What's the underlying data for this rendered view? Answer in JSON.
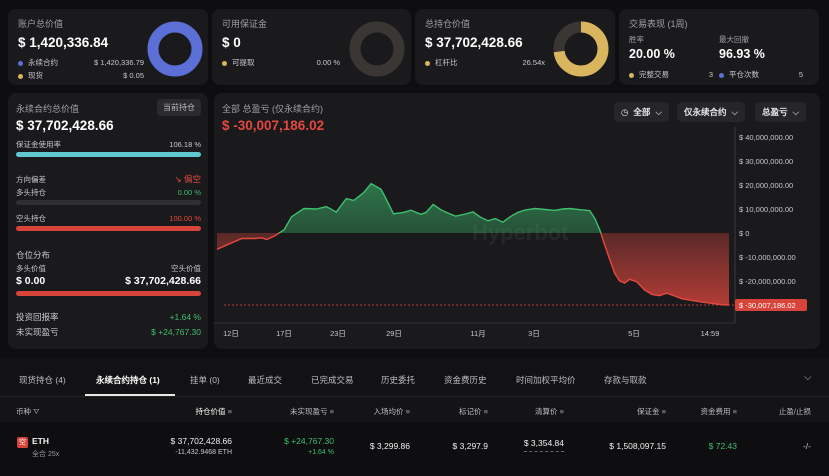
{
  "cards": {
    "account": {
      "title": "账户总价值",
      "value": "$ 1,420,336.84",
      "perp_label": "永续合约",
      "perp_value": "$ 1,420,336.79",
      "spot_label": "现货",
      "spot_value": "$ 0.05",
      "perp_fraction": 1.0
    },
    "margin": {
      "title": "可用保证金",
      "value": "$ 0",
      "withdraw_label": "可提取",
      "withdraw_value": "0.00 %",
      "fraction": 0.0
    },
    "position": {
      "title": "总持仓价值",
      "value": "$ 37,702,428.66",
      "leverage_label": "杠杆比",
      "leverage_value": "26.54x",
      "fraction": 0.73
    },
    "performance": {
      "title": "交易表现 (1周)",
      "winrate_label": "胜率",
      "winrate_value": "20.00 %",
      "drawdown_label": "最大回撤",
      "drawdown_value": "96.93 %",
      "trades_label": "完整交易",
      "trades_value": "3",
      "close_label": "平仓次数",
      "close_value": "5"
    }
  },
  "left": {
    "perp_total_label": "永续合约总价值",
    "current_pos_btn": "当前持仓",
    "perp_total_value": "$ 37,702,428.66",
    "margin_usage_label": "保证金使用率",
    "margin_usage_value": "106.18 %",
    "bias_label": "方向偏差",
    "bias_value": "偏空",
    "long_label": "多头持仓",
    "long_value": "0.00 %",
    "short_label": "空头持仓",
    "short_value": "100.00 %",
    "dist_label": "仓位分布",
    "long_value_label": "多头价值",
    "short_value_label": "空头价值",
    "long_amount": "$ 0.00",
    "short_amount": "$ 37,702,428.66",
    "roi_label": "投资回报率",
    "roi_value": "+1.64 %",
    "upnl_label": "未实现盈亏",
    "upnl_value": "$ +24,767.30"
  },
  "chart_header": {
    "title": "全部 总盈亏 (仅永续合约)",
    "value": "$ -30,007,186.02",
    "filter_all": "全部",
    "filter_perp": "仅永续合约",
    "filter_pnl": "总盈亏",
    "watermark": "Hyperbot"
  },
  "chart_data": {
    "type": "area",
    "title": "全部 总盈亏 (仅永续合约)",
    "x_ticks": [
      "12日",
      "17日",
      "23日",
      "29日",
      "11月",
      "3日",
      "5日",
      "14:59"
    ],
    "y_ticks": [
      "$ 40,000,000.00",
      "$ 30,000,000.00",
      "$ 20,000,000.00",
      "$ 10,000,000.00",
      "$ 0",
      "$ -10,000,000.00",
      "$ -20,000,000.00"
    ],
    "ylim": [
      -30007186.02,
      40000000
    ],
    "last_value_label": "$ -30,007,186.02",
    "points": [
      [
        0,
        -6800000
      ],
      [
        5,
        -4500000
      ],
      [
        10,
        -2300000
      ],
      [
        15,
        -2300000
      ],
      [
        18,
        -2000000
      ],
      [
        20,
        -2700000
      ],
      [
        23,
        -1300000
      ],
      [
        27,
        1300000
      ],
      [
        30,
        6800000
      ],
      [
        35,
        10200000
      ],
      [
        40,
        10000000
      ],
      [
        44,
        11000000
      ],
      [
        48,
        8700000
      ],
      [
        52,
        14300000
      ],
      [
        55,
        13600000
      ],
      [
        59,
        16800000
      ],
      [
        62,
        20600000
      ],
      [
        66,
        18200000
      ],
      [
        68,
        14300000
      ],
      [
        71,
        8000000
      ],
      [
        75,
        8600000
      ],
      [
        78,
        9500000
      ],
      [
        82,
        7800000
      ],
      [
        84,
        8500000
      ],
      [
        87,
        11900000
      ],
      [
        90,
        9700000
      ],
      [
        93,
        8300000
      ],
      [
        96,
        7000000
      ],
      [
        100,
        7900000
      ],
      [
        103,
        8800000
      ],
      [
        106,
        6600000
      ],
      [
        109,
        5100000
      ],
      [
        112,
        6000000
      ],
      [
        115,
        4500000
      ],
      [
        118,
        6800000
      ],
      [
        121,
        8600000
      ],
      [
        124,
        9600000
      ],
      [
        128,
        10200000
      ],
      [
        132,
        9800000
      ],
      [
        136,
        9400000
      ],
      [
        139,
        10000000
      ],
      [
        142,
        10200000
      ],
      [
        146,
        9700000
      ],
      [
        150,
        9300000
      ],
      [
        152,
        6100000
      ],
      [
        154,
        1300000
      ],
      [
        156,
        -5000000
      ],
      [
        158,
        -11000000
      ],
      [
        160,
        -16800000
      ],
      [
        162,
        -20000000
      ],
      [
        164,
        -20900000
      ],
      [
        166,
        -19300000
      ],
      [
        169,
        -20400000
      ],
      [
        172,
        -23700000
      ],
      [
        175,
        -25600000
      ],
      [
        178,
        -26100000
      ],
      [
        181,
        -25100000
      ],
      [
        184,
        -26200000
      ],
      [
        187,
        -27400000
      ],
      [
        191,
        -28100000
      ],
      [
        195,
        -28800000
      ],
      [
        199,
        -29300000
      ],
      [
        203,
        -29900000
      ],
      [
        206,
        -30007186
      ]
    ],
    "x_range": [
      0,
      206
    ]
  },
  "tabs": [
    {
      "label": "现货持仓 (4)"
    },
    {
      "label": "永续合约持仓 (1)"
    },
    {
      "label": "挂单 (0)"
    },
    {
      "label": "最近成交"
    },
    {
      "label": "已完成交易"
    },
    {
      "label": "历史委托"
    },
    {
      "label": "资金费历史"
    },
    {
      "label": "时间加权平均价"
    },
    {
      "label": "存款与取款"
    }
  ],
  "table": {
    "headers": [
      "币种",
      "持仓价值",
      "未实现盈亏",
      "入场均价",
      "标记价",
      "清算价",
      "保证金",
      "资金费用",
      "止盈/止损"
    ],
    "row": {
      "coin": "ETH",
      "coin_badge": "空",
      "mode": "全合 25x",
      "position_value": "$ 37,702,428.66",
      "position_size": "-11,432.9468 ETH",
      "upnl": "$ +24,767.30",
      "upnl_pct": "+1.64 %",
      "entry": "$ 3,299.86",
      "mark": "$ 3,297.9",
      "liq": "$ 3,354.84",
      "margin": "$ 1,508,097.15",
      "funding": "$ 72.43",
      "tpsl": "-/-"
    }
  },
  "colors": {
    "blue": "#5b6fd6",
    "gold": "#d9b65e",
    "teal": "#5fc8d0",
    "red": "#e5483f",
    "green": "#3fbf6e"
  }
}
